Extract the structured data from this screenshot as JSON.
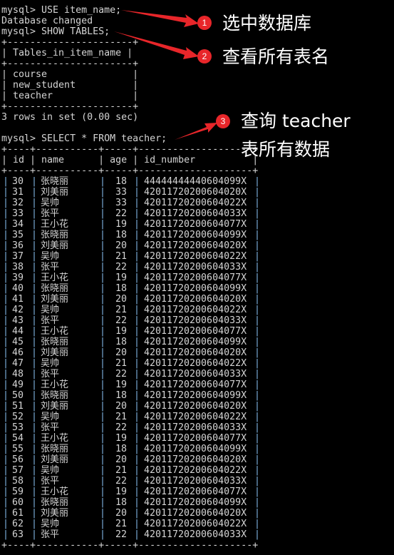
{
  "terminal": {
    "lines": [
      "mysql> USE item_name;",
      "Database changed",
      "mysql> SHOW TABLES;",
      "+----------------------+",
      "| Tables_in_item_name |",
      "+----------------------+",
      "| course               |",
      "| new_student          |",
      "| teacher              |",
      "+----------------------+",
      "3 rows in set (0.00 sec)",
      "",
      "mysql> SELECT * FROM teacher;",
      "+----+-----------+-----+--------------------+",
      "| id | name      | age | id_number          |",
      "+----+-----------+-----+--------------------+"
    ],
    "bottom_border": "+----+-----------+-----+--------------------+"
  },
  "teacher_table": {
    "columns": [
      "id",
      "name",
      "age",
      "id_number"
    ],
    "rows": [
      [
        "30",
        "张晓丽",
        "18",
        "44444444440604099X"
      ],
      [
        "31",
        "刘美丽",
        "33",
        "42011720200604020X"
      ],
      [
        "32",
        "吴帅",
        "33",
        "42011720200604022X"
      ],
      [
        "33",
        "张平",
        "22",
        "42011720200604033X"
      ],
      [
        "34",
        "王小花",
        "19",
        "42011720200604077X"
      ],
      [
        "35",
        "张晓丽",
        "18",
        "42011720200604099X"
      ],
      [
        "36",
        "刘美丽",
        "20",
        "42011720200604020X"
      ],
      [
        "37",
        "吴帅",
        "21",
        "42011720200604022X"
      ],
      [
        "38",
        "张平",
        "22",
        "42011720200604033X"
      ],
      [
        "39",
        "王小花",
        "19",
        "42011720200604077X"
      ],
      [
        "40",
        "张晓丽",
        "18",
        "42011720200604099X"
      ],
      [
        "41",
        "刘美丽",
        "20",
        "42011720200604020X"
      ],
      [
        "42",
        "吴帅",
        "21",
        "42011720200604022X"
      ],
      [
        "43",
        "张平",
        "22",
        "42011720200604033X"
      ],
      [
        "44",
        "王小花",
        "19",
        "42011720200604077X"
      ],
      [
        "45",
        "张晓丽",
        "18",
        "42011720200604099X"
      ],
      [
        "46",
        "刘美丽",
        "20",
        "42011720200604020X"
      ],
      [
        "47",
        "吴帅",
        "21",
        "42011720200604022X"
      ],
      [
        "48",
        "张平",
        "22",
        "42011720200604033X"
      ],
      [
        "49",
        "王小花",
        "19",
        "42011720200604077X"
      ],
      [
        "50",
        "张晓丽",
        "18",
        "42011720200604099X"
      ],
      [
        "51",
        "刘美丽",
        "20",
        "42011720200604020X"
      ],
      [
        "52",
        "吴帅",
        "21",
        "42011720200604022X"
      ],
      [
        "53",
        "张平",
        "22",
        "42011720200604033X"
      ],
      [
        "54",
        "王小花",
        "19",
        "42011720200604077X"
      ],
      [
        "55",
        "张晓丽",
        "18",
        "42011720200604099X"
      ],
      [
        "56",
        "刘美丽",
        "20",
        "42011720200604020X"
      ],
      [
        "57",
        "吴帅",
        "21",
        "42011720200604022X"
      ],
      [
        "58",
        "张平",
        "22",
        "42011720200604033X"
      ],
      [
        "59",
        "王小花",
        "19",
        "42011720200604077X"
      ],
      [
        "60",
        "张晓丽",
        "18",
        "42011720200604099X"
      ],
      [
        "61",
        "刘美丽",
        "20",
        "42011720200604020X"
      ],
      [
        "62",
        "吴帅",
        "21",
        "42011720200604022X"
      ],
      [
        "63",
        "张平",
        "22",
        "42011720200604033X"
      ]
    ]
  },
  "annotations": {
    "accent_color": "#e8262a",
    "items": [
      {
        "number": "1",
        "text": "选中数据库"
      },
      {
        "number": "2",
        "text": "查看所有表名"
      },
      {
        "number": "3",
        "text": "查询 teacher",
        "text2": "表所有数据"
      }
    ]
  }
}
